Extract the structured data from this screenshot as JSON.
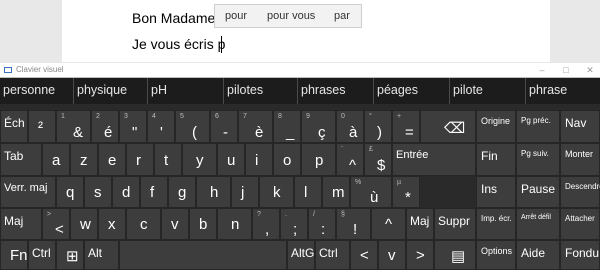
{
  "document": {
    "line1": "Bon Madame,",
    "line2": "Je vous écris p"
  },
  "suggestions": [
    "pour",
    "pour vous",
    "par"
  ],
  "keyboard": {
    "title": "Clavier visuel",
    "window_buttons": [
      "–",
      "□",
      "✕"
    ],
    "predictions": [
      "personne",
      "physique",
      "pH",
      "pilotes",
      "phrases",
      "péages",
      "pilote",
      "phrase"
    ],
    "row1": {
      "keys": [
        {
          "main": "Éch",
          "sup": ""
        },
        {
          "main": "²",
          "sup": ""
        },
        {
          "main": "&",
          "sup": "1"
        },
        {
          "main": "é",
          "sup": "2"
        },
        {
          "main": "\"",
          "sup": "3"
        },
        {
          "main": "'",
          "sup": "4"
        },
        {
          "main": "(",
          "sup": "5"
        },
        {
          "main": "-",
          "sup": "6"
        },
        {
          "main": "è",
          "sup": "7"
        },
        {
          "main": "_",
          "sup": "8"
        },
        {
          "main": "ç",
          "sup": "9"
        },
        {
          "main": "à",
          "sup": "0"
        },
        {
          "main": ")",
          "sup": "°"
        },
        {
          "main": "=",
          "sup": "+"
        },
        {
          "main": "⌫",
          "sup": ""
        }
      ],
      "right": [
        "Origine",
        "Pg préc.",
        "Nav"
      ]
    },
    "row2": {
      "keys": [
        {
          "main": "Tab",
          "sup": ""
        },
        {
          "main": "a",
          "sup": ""
        },
        {
          "main": "z",
          "sup": ""
        },
        {
          "main": "e",
          "sup": ""
        },
        {
          "main": "r",
          "sup": ""
        },
        {
          "main": "t",
          "sup": ""
        },
        {
          "main": "y",
          "sup": ""
        },
        {
          "main": "u",
          "sup": ""
        },
        {
          "main": "i",
          "sup": ""
        },
        {
          "main": "o",
          "sup": ""
        },
        {
          "main": "p",
          "sup": ""
        },
        {
          "main": "^",
          "sup": "¨"
        },
        {
          "main": "$",
          "sup": "£"
        },
        {
          "main": "Entrée",
          "sup": ""
        }
      ],
      "right": [
        "Fin",
        "Pg suiv.",
        "Monter"
      ]
    },
    "row3": {
      "keys": [
        {
          "main": "Verr. maj",
          "sup": ""
        },
        {
          "main": "q",
          "sup": ""
        },
        {
          "main": "s",
          "sup": ""
        },
        {
          "main": "d",
          "sup": ""
        },
        {
          "main": "f",
          "sup": ""
        },
        {
          "main": "g",
          "sup": ""
        },
        {
          "main": "h",
          "sup": ""
        },
        {
          "main": "j",
          "sup": ""
        },
        {
          "main": "k",
          "sup": ""
        },
        {
          "main": "l",
          "sup": ""
        },
        {
          "main": "m",
          "sup": ""
        },
        {
          "main": "ù",
          "sup": "%"
        },
        {
          "main": "*",
          "sup": "µ"
        }
      ],
      "right": [
        "Ins",
        "Pause",
        "Descendre"
      ]
    },
    "row4": {
      "keys": [
        {
          "main": "Maj",
          "sup": ""
        },
        {
          "main": "<",
          "sup": ">"
        },
        {
          "main": "w",
          "sup": ""
        },
        {
          "main": "x",
          "sup": ""
        },
        {
          "main": "c",
          "sup": ""
        },
        {
          "main": "v",
          "sup": ""
        },
        {
          "main": "b",
          "sup": ""
        },
        {
          "main": "n",
          "sup": ""
        },
        {
          "main": ",",
          "sup": "?"
        },
        {
          "main": ";",
          "sup": "."
        },
        {
          "main": ":",
          "sup": "/"
        },
        {
          "main": "!",
          "sup": "§"
        },
        {
          "main": "^",
          "sup": ""
        },
        {
          "main": "Maj",
          "sup": ""
        },
        {
          "main": "Suppr",
          "sup": ""
        }
      ],
      "right": [
        "Imp. écr.",
        "Arrêt défil",
        "Attacher"
      ]
    },
    "row5": {
      "keys": [
        {
          "main": "Fn",
          "sup": ""
        },
        {
          "main": "Ctrl",
          "sup": ""
        },
        {
          "main": "⊞",
          "sup": ""
        },
        {
          "main": "Alt",
          "sup": ""
        },
        {
          "main": "",
          "sup": ""
        },
        {
          "main": "AltGr",
          "sup": ""
        },
        {
          "main": "Ctrl",
          "sup": ""
        },
        {
          "main": "<",
          "sup": ""
        },
        {
          "main": "v",
          "sup": ""
        },
        {
          "main": ">",
          "sup": ""
        },
        {
          "main": "▤",
          "sup": ""
        }
      ],
      "right": [
        "Options",
        "Aide",
        "Fondu"
      ]
    }
  }
}
